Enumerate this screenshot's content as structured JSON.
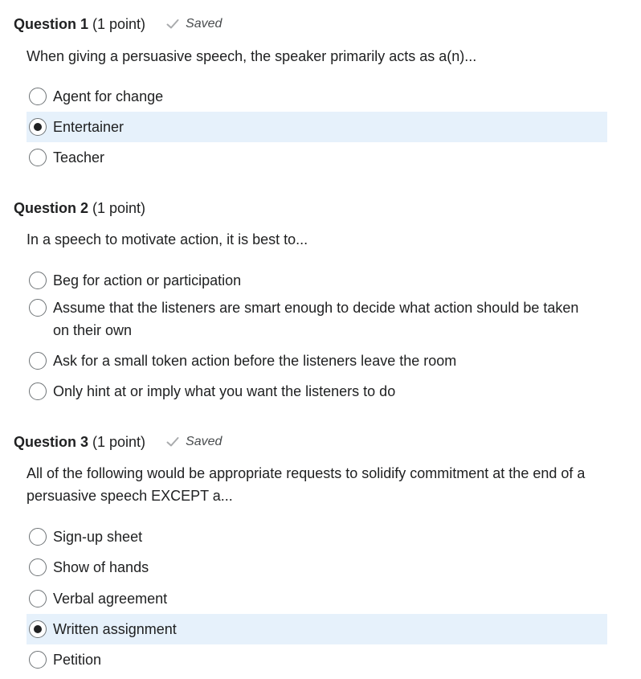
{
  "questions": [
    {
      "title": "Question 1",
      "points": "(1 point)",
      "saved": true,
      "saved_label": "Saved",
      "saved_icon": "check-icon",
      "text": "When giving a persuasive speech, the speaker primarily acts as a(n)...",
      "options": [
        {
          "label": "Agent for change",
          "selected": false
        },
        {
          "label": "Entertainer",
          "selected": true
        },
        {
          "label": "Teacher",
          "selected": false
        }
      ]
    },
    {
      "title": "Question 2",
      "points": "(1 point)",
      "saved": false,
      "text": "In a speech to motivate action, it is best to...",
      "options": [
        {
          "label": "Beg for action or participation",
          "selected": false
        },
        {
          "label": "Assume that the listeners are smart enough to decide what action should be taken on their own",
          "selected": false
        },
        {
          "label": "Ask for a small token action before the listeners leave the room",
          "selected": false
        },
        {
          "label": "Only hint at or imply what you want the listeners to do",
          "selected": false
        }
      ]
    },
    {
      "title": "Question 3",
      "points": "(1 point)",
      "saved": true,
      "saved_label": "Saved",
      "saved_icon": "check-icon",
      "text": "All of the following would be appropriate requests to solidify commitment at the end of a persuasive speech EXCEPT a...",
      "options": [
        {
          "label": "Sign-up sheet",
          "selected": false
        },
        {
          "label": "Show of hands",
          "selected": false
        },
        {
          "label": "Verbal agreement",
          "selected": false
        },
        {
          "label": "Written assignment",
          "selected": true
        },
        {
          "label": "Petition",
          "selected": false
        }
      ]
    }
  ],
  "colors": {
    "selected_row_bg": "#e6f1fb",
    "text": "#202122",
    "saved_text": "#494c4e",
    "check": "#a9abad"
  }
}
